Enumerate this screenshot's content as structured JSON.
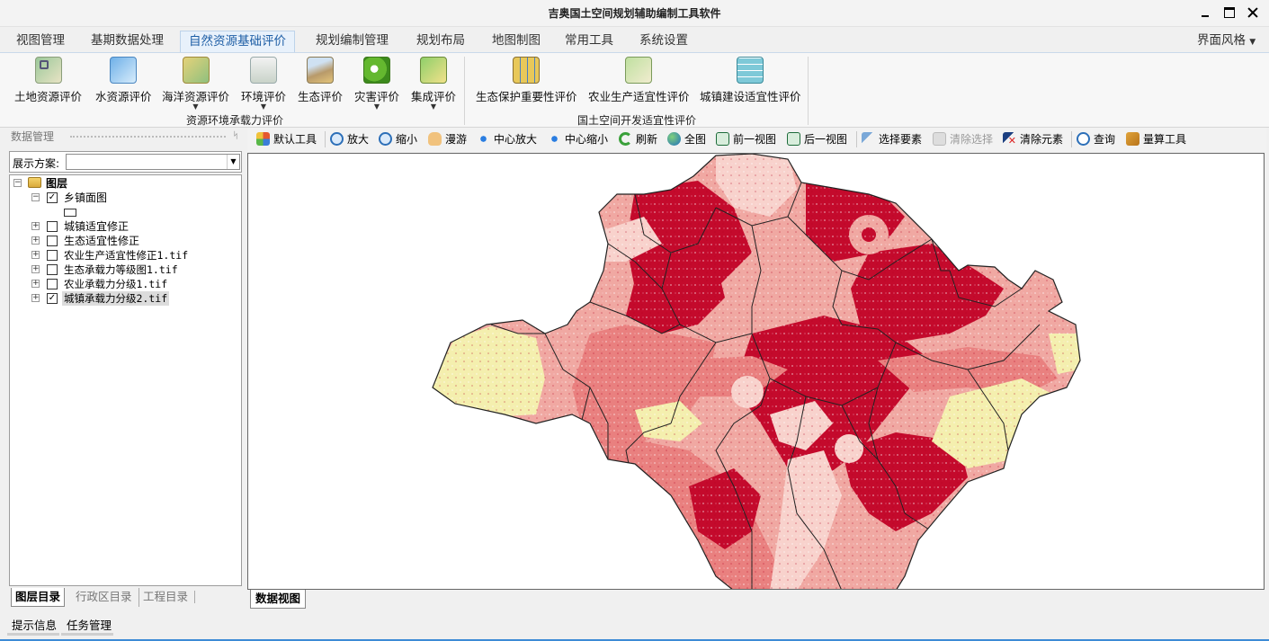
{
  "window": {
    "title": "吉奥国土空间规划辅助编制工具软件"
  },
  "menu": {
    "tabs": [
      "视图管理",
      "基期数据处理",
      "自然资源基础评价",
      "规划编制管理",
      "规划布局",
      "地图制图",
      "常用工具",
      "系统设置"
    ],
    "active_index": 2,
    "style": "界面风格"
  },
  "ribbon": {
    "group1": {
      "label": "资源环境承载力评价",
      "buttons": [
        "土地资源评价",
        "水资源评价",
        "海洋资源评价",
        "环境评价",
        "生态评价",
        "灾害评价",
        "集成评价"
      ]
    },
    "group2": {
      "label": "国土空间开发适宜性评价",
      "buttons": [
        "生态保护重要性评价",
        "农业生产适宜性评价",
        "城镇建设适宜性评价"
      ]
    }
  },
  "left_panel": {
    "header": "数据管理",
    "scheme_label": "展示方案:",
    "scheme_value": "",
    "tree_root": "图层",
    "layers": [
      {
        "name": "乡镇面图",
        "checked": true,
        "expanded": true
      },
      {
        "name": "城镇适宜修正",
        "checked": false
      },
      {
        "name": "生态适宜性修正",
        "checked": false
      },
      {
        "name": "农业生产适宜性修正1.tif",
        "checked": false
      },
      {
        "name": "生态承载力等级图1.tif",
        "checked": false
      },
      {
        "name": "农业承载力分级1.tif",
        "checked": false
      },
      {
        "name": "城镇承载力分级2.tif",
        "checked": true,
        "selected": true
      }
    ],
    "bottom_tabs": [
      "图层目录",
      "行政区目录",
      "工程目录"
    ]
  },
  "map_toolbar": {
    "tools": [
      "默认工具",
      "放大",
      "缩小",
      "漫游",
      "中心放大",
      "中心缩小",
      "刷新",
      "全图",
      "前一视图",
      "后一视图",
      "选择要素",
      "清除选择",
      "清除元素",
      "查询",
      "量算工具"
    ],
    "disabled": [
      "清除选择"
    ]
  },
  "map": {
    "view_tab": "数据视图",
    "colors": {
      "high": "#c40a2c",
      "mid_high": "#e9807f",
      "mid": "#f0a8a2",
      "low": "#f8d2cc",
      "very_low": "#f4efae",
      "boundary": "#222222"
    }
  },
  "status": {
    "tabs": [
      "提示信息",
      "任务管理"
    ]
  }
}
